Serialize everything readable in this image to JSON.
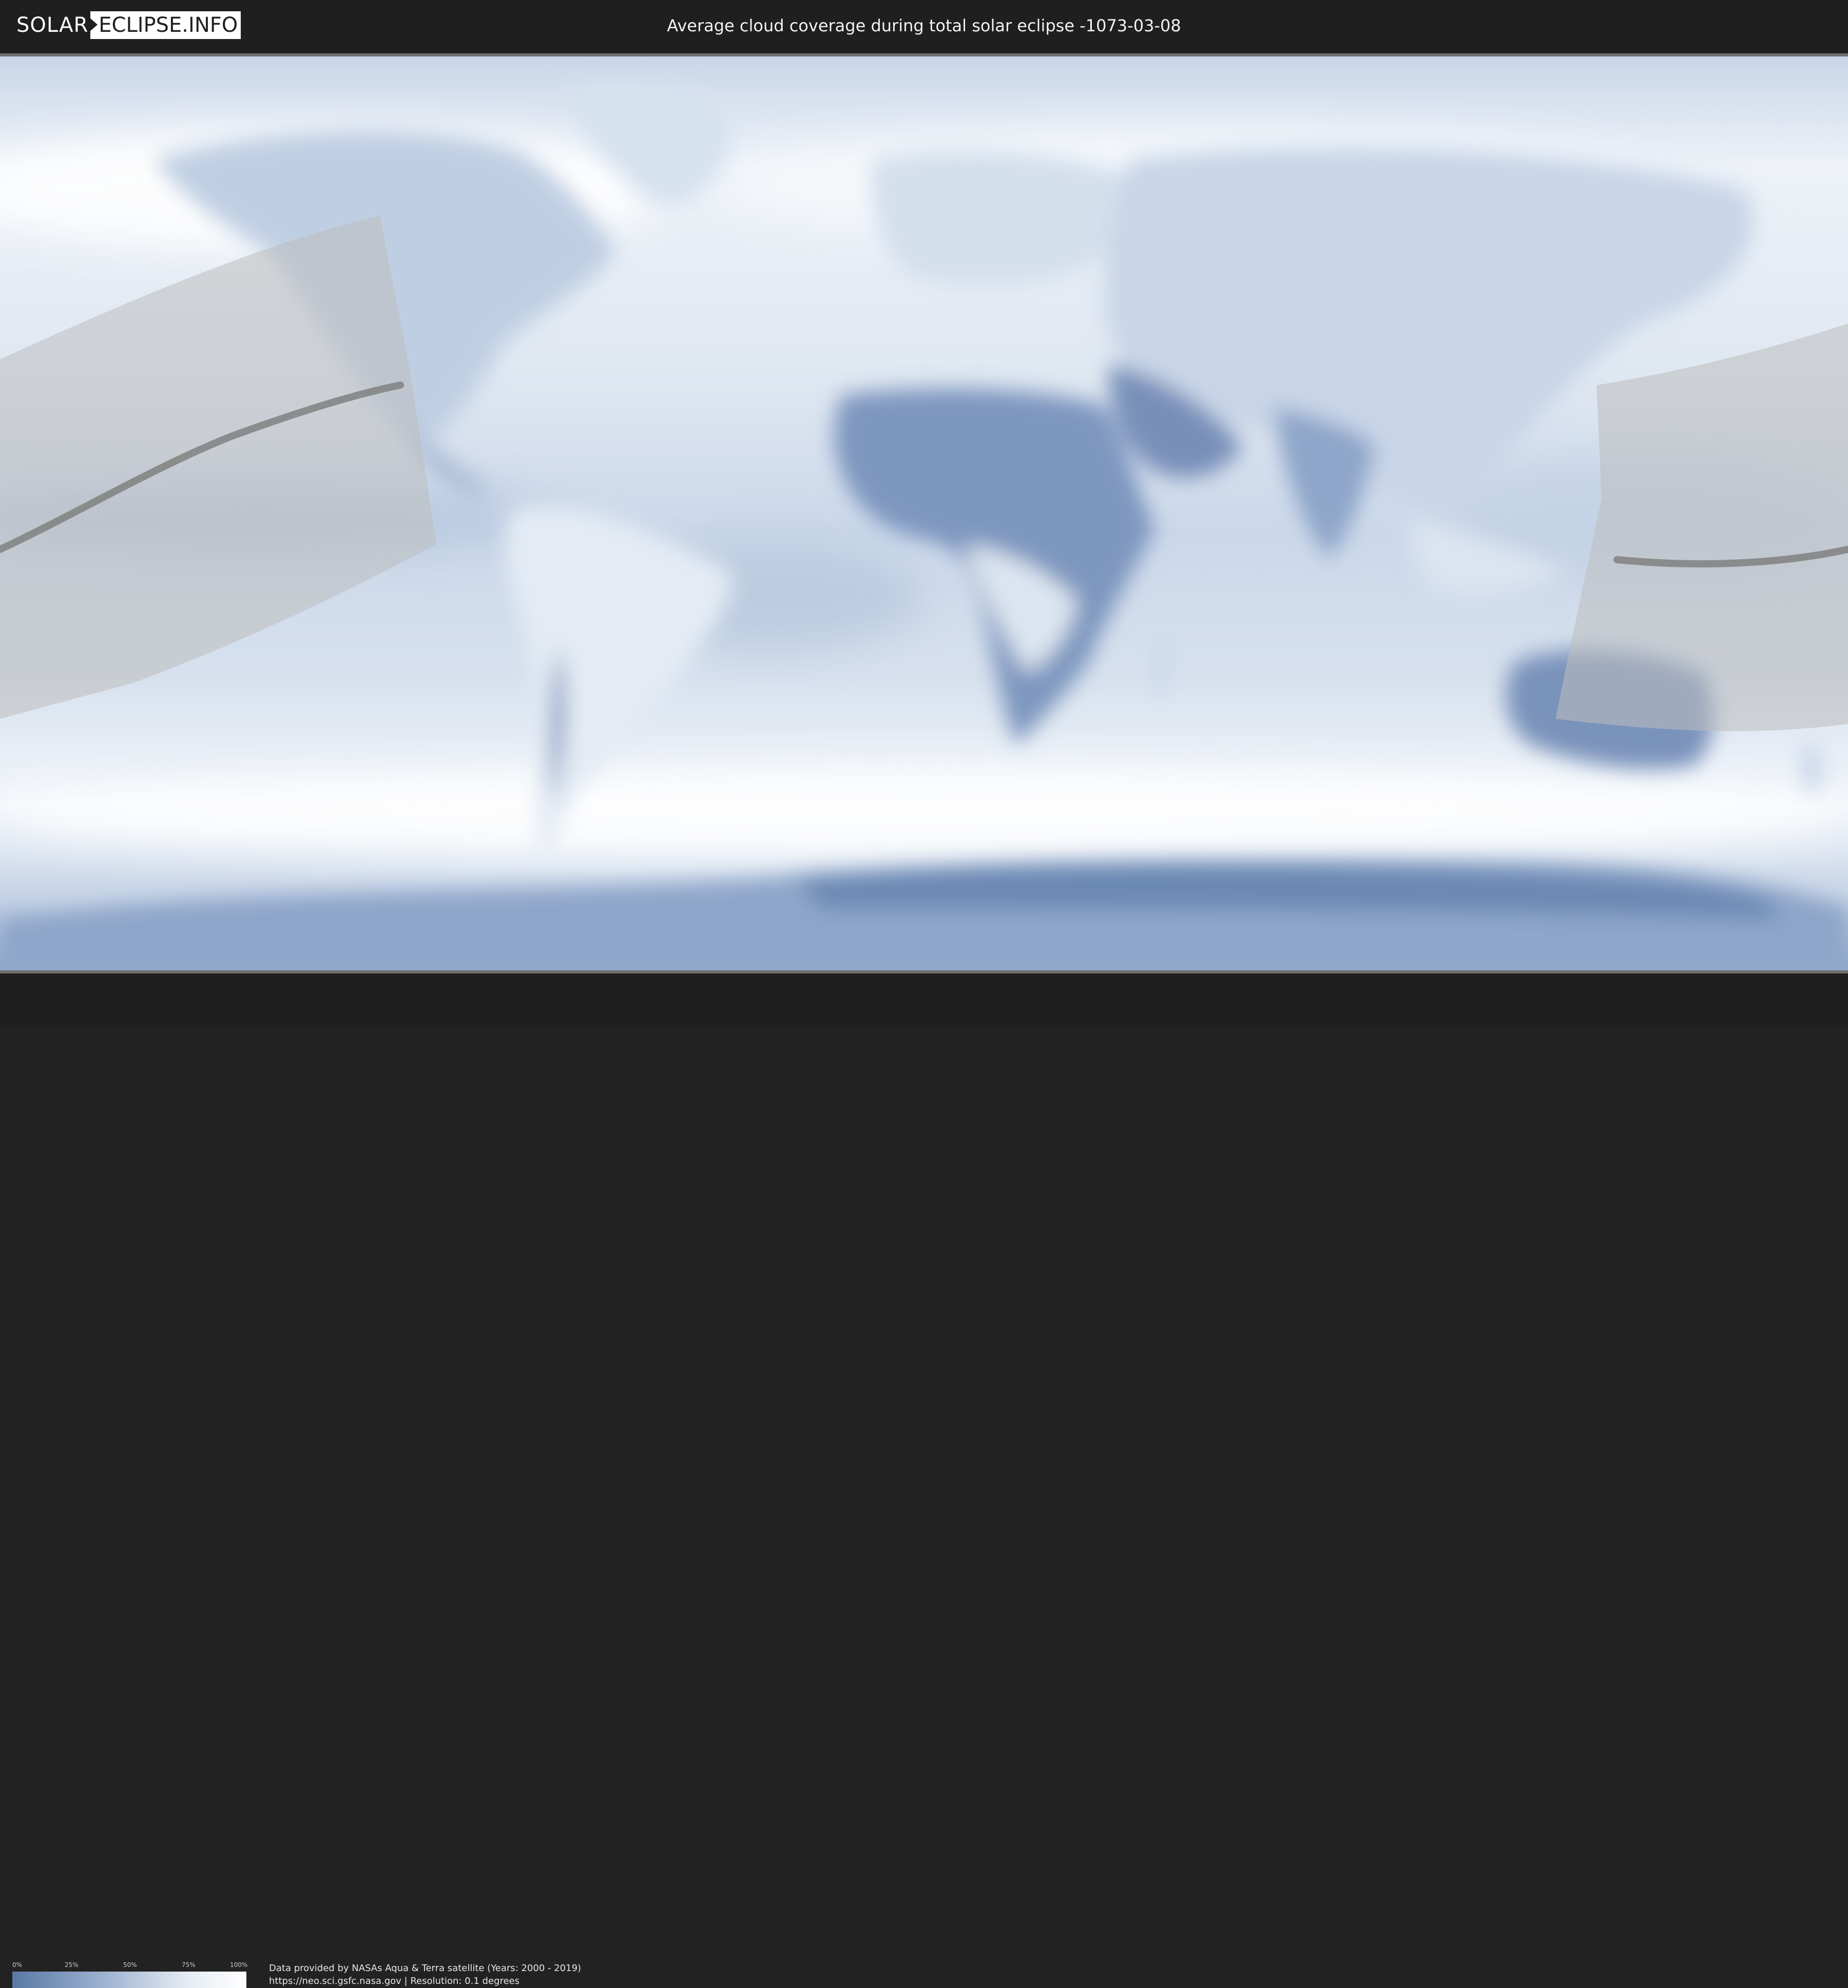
{
  "header": {
    "logo_left": "SOLAR",
    "logo_right": "ECLIPSE.INFO",
    "title": "Average cloud coverage during total solar eclipse -1073-03-08"
  },
  "legend": {
    "ticks": [
      "0%",
      "25%",
      "50%",
      "75%",
      "100%"
    ],
    "scale_colors": [
      "#5a78a6",
      "#9fb4d1",
      "#e6ecf4",
      "#ffffff"
    ]
  },
  "footer": {
    "credit_line_1": "Data provided by NASAs Aqua & Terra satellite (Years: 2000 - 2019)",
    "credit_line_2": "https://neo.sci.gsfc.nasa.gov | Resolution: 0.1 degrees"
  },
  "colors": {
    "header_bg": "#1f1f1f",
    "cloud_low": "#6a86b3",
    "cloud_high": "#ffffff",
    "eclipse_path": "#808080"
  }
}
